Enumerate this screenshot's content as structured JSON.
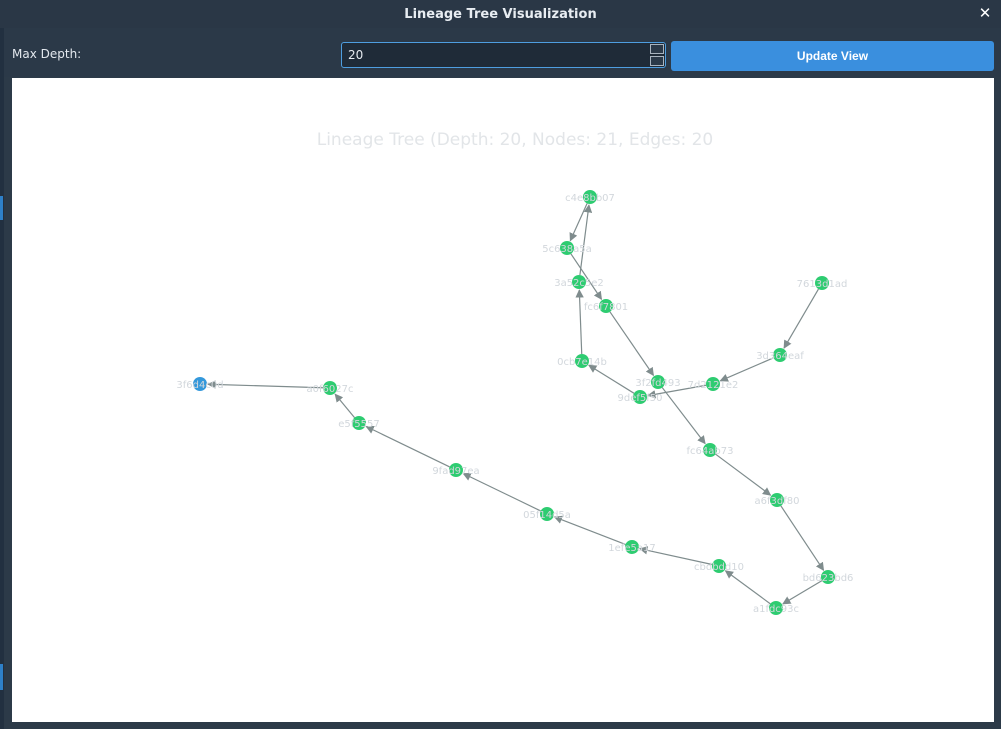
{
  "window": {
    "title": "Lineage Tree Visualization",
    "close_label": "✕"
  },
  "controls": {
    "max_depth_label": "Max Depth:",
    "max_depth_value": "20",
    "update_label": "Update View"
  },
  "graph": {
    "title": "Lineage Tree (Depth: 20, Nodes: 21, Edges: 20",
    "node_color": "#2ecc71",
    "root_color": "#3498db",
    "edge_color": "#7f8c8d",
    "nodes": [
      {
        "id": "n1",
        "label": "3f6d4c0d",
        "root": true
      },
      {
        "id": "n2",
        "label": "a0f6027c"
      },
      {
        "id": "n3",
        "label": "e5f5557"
      },
      {
        "id": "n4",
        "label": "9fad97ea"
      },
      {
        "id": "n5",
        "label": "05f14d5a"
      },
      {
        "id": "n6",
        "label": "1efe5a17"
      },
      {
        "id": "n7",
        "label": "cbdbdd10"
      },
      {
        "id": "n8",
        "label": "a1fdc93c"
      },
      {
        "id": "n9",
        "label": "bd623bd6"
      },
      {
        "id": "n10",
        "label": "a6f3df80"
      },
      {
        "id": "n11",
        "label": "fc64ab73"
      },
      {
        "id": "n12",
        "label": "3f2fd493"
      },
      {
        "id": "n13",
        "label": "9def5f50"
      },
      {
        "id": "n14",
        "label": "0cb7e14b"
      },
      {
        "id": "n15",
        "label": "3a52c5e2"
      },
      {
        "id": "n16",
        "label": "fc6f7801"
      },
      {
        "id": "n17",
        "label": "5c638a5a"
      },
      {
        "id": "n18",
        "label": "c4e8bb07"
      },
      {
        "id": "n19",
        "label": "7d2121e2"
      },
      {
        "id": "n20",
        "label": "3d364eaf"
      },
      {
        "id": "n21",
        "label": "7613d1ad"
      }
    ],
    "edges": [
      [
        "n2",
        "n1"
      ],
      [
        "n3",
        "n2"
      ],
      [
        "n4",
        "n3"
      ],
      [
        "n5",
        "n4"
      ],
      [
        "n6",
        "n5"
      ],
      [
        "n7",
        "n6"
      ],
      [
        "n8",
        "n7"
      ],
      [
        "n9",
        "n8"
      ],
      [
        "n10",
        "n9"
      ],
      [
        "n11",
        "n10"
      ],
      [
        "n12",
        "n11"
      ],
      [
        "n16",
        "n12"
      ],
      [
        "n17",
        "n16"
      ],
      [
        "n18",
        "n17"
      ],
      [
        "n15",
        "n18"
      ],
      [
        "n14",
        "n15"
      ],
      [
        "n13",
        "n14"
      ],
      [
        "n19",
        "n13"
      ],
      [
        "n20",
        "n19"
      ],
      [
        "n21",
        "n20"
      ]
    ]
  }
}
